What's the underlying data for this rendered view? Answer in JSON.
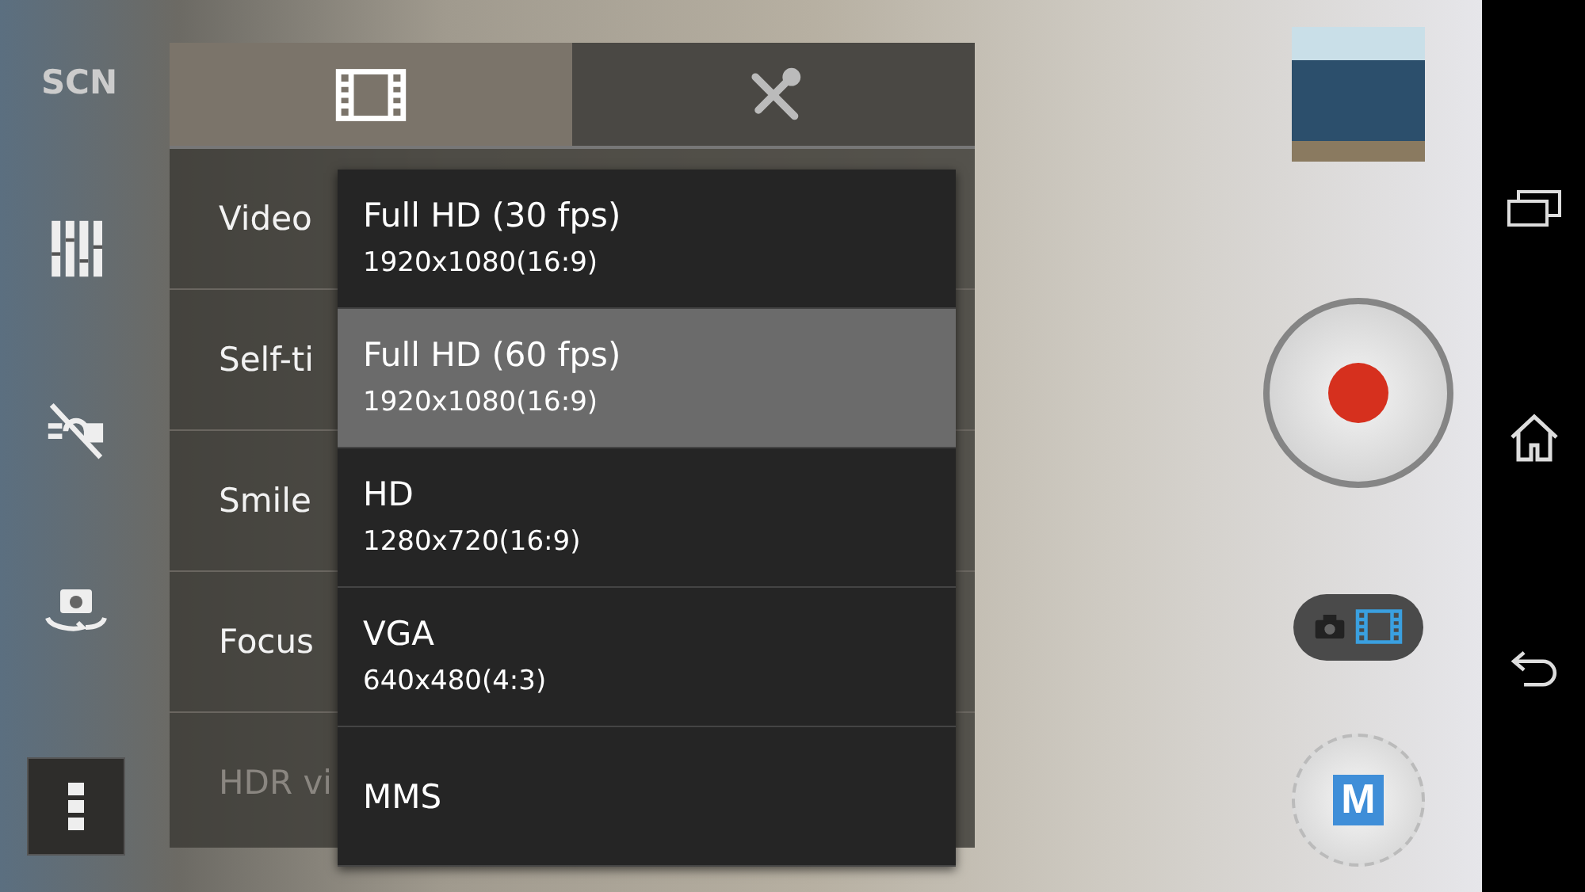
{
  "scene_label": "SCN",
  "settings_panel": {
    "tabs": [
      {
        "kind": "video",
        "selected": true
      },
      {
        "kind": "tools",
        "selected": false
      }
    ],
    "rows": [
      {
        "label": "Video",
        "disabled": false
      },
      {
        "label": "Self-ti",
        "disabled": false
      },
      {
        "label": "Smile",
        "disabled": false
      },
      {
        "label": "Focus",
        "disabled": false
      },
      {
        "label": "HDR vi",
        "disabled": true
      }
    ]
  },
  "resolution_menu": {
    "options": [
      {
        "title": "Full HD (30 fps)",
        "detail": "1920x1080(16:9)",
        "selected": false
      },
      {
        "title": "Full HD (60 fps)",
        "detail": "1920x1080(16:9)",
        "selected": true
      },
      {
        "title": "HD",
        "detail": "1280x720(16:9)",
        "selected": false
      },
      {
        "title": "VGA",
        "detail": "640x480(4:3)",
        "selected": false
      },
      {
        "title": "MMS",
        "selected": false
      }
    ]
  },
  "mode_switch": [
    {
      "kind": "photo",
      "selected": false
    },
    {
      "kind": "video",
      "selected": true
    }
  ],
  "shooting_mode": {
    "label": "M"
  }
}
